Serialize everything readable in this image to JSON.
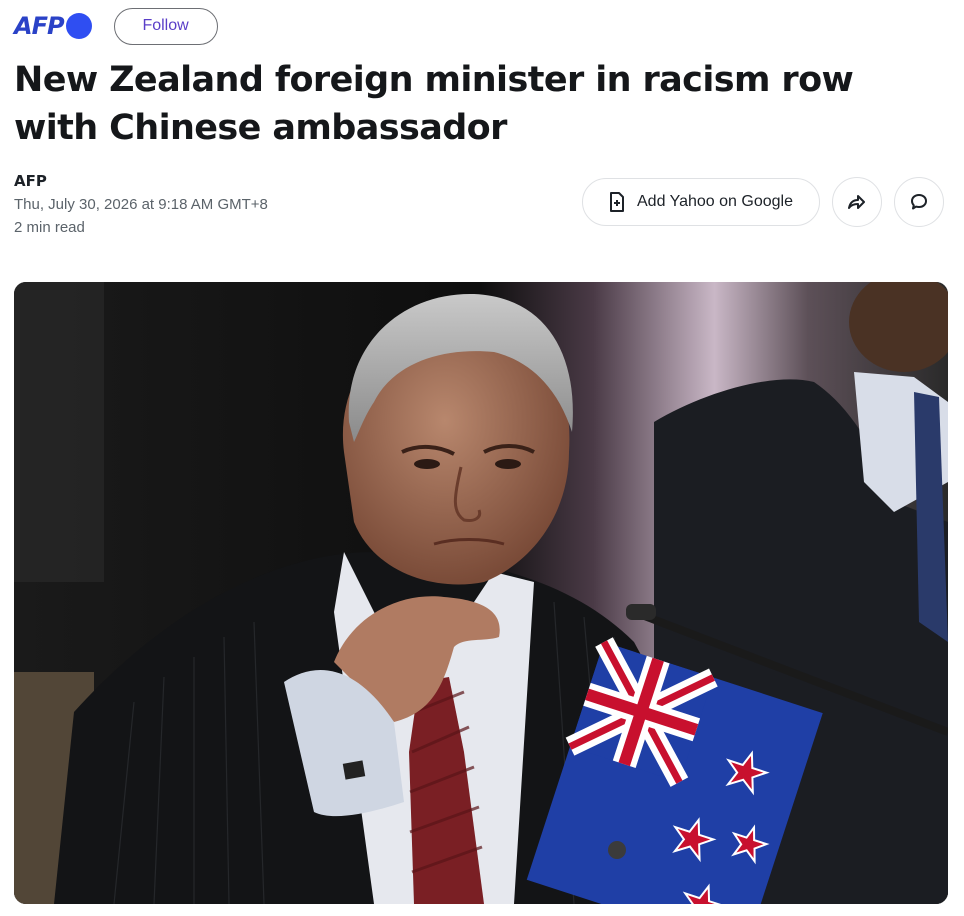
{
  "publisher": {
    "logo_text": "AFP",
    "follow_label": "Follow"
  },
  "article": {
    "headline": "New Zealand foreign minister in racism row with Chinese ambassador",
    "author": "AFP",
    "timestamp": "Thu, July 30, 2026 at 9:18 AM GMT+8",
    "read_time": "2 min read",
    "image_alt": "New Zealand foreign minister seated beside a New Zealand flag"
  },
  "actions": {
    "add_google_label": "Add Yahoo on Google",
    "share_icon": "share-arrow-icon",
    "comment_icon": "comment-bubble-icon"
  },
  "colors": {
    "brand_blue": "#2f4ef2",
    "follow_text": "#5a3ec8",
    "headline": "#15171a"
  }
}
